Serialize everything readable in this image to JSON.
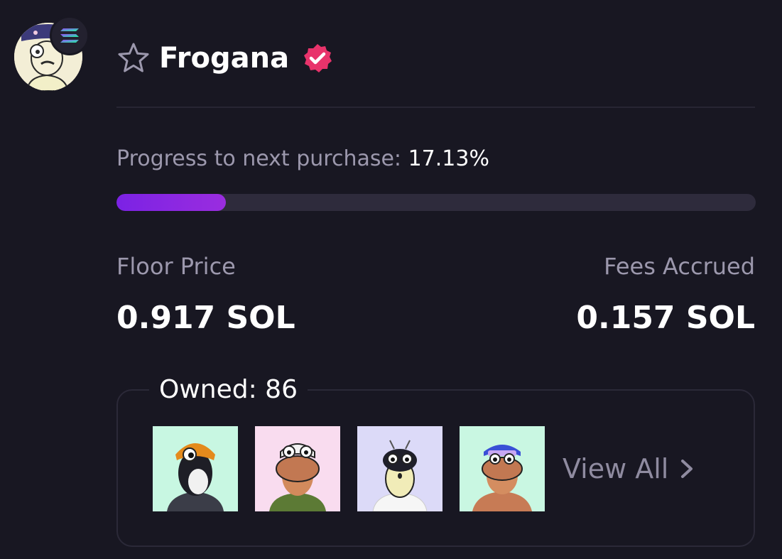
{
  "collection": {
    "name": "Frogana",
    "verified": true,
    "chain_icon": "solana-icon",
    "favorite_icon": "star-outline-icon"
  },
  "progress": {
    "label": "Progress to next purchase:",
    "value_text": "17.13%",
    "fraction": 0.1713
  },
  "stats": {
    "floor_price": {
      "label": "Floor Price",
      "value": "0.917 SOL"
    },
    "fees_accrued": {
      "label": "Fees Accrued",
      "value": "0.157 SOL"
    }
  },
  "owned": {
    "label": "Owned: 86",
    "view_all_label": "View All",
    "thumbnail_backgrounds": [
      "#c8f7e2",
      "#f9dcef",
      "#dcdaf8",
      "#c9f7e2"
    ]
  },
  "colors": {
    "background": "#181722",
    "accent_purple": "#8a27e3",
    "verified_pink": "#e8336b",
    "muted_text": "#9c98ad"
  }
}
